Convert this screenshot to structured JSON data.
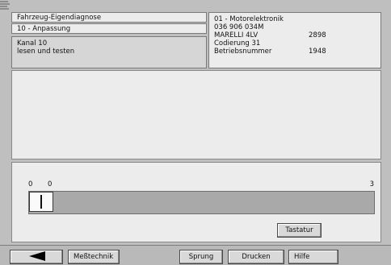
{
  "header_left": {
    "title": "Fahrzeug-Eigendiagnose",
    "function": "10 - Anpassung",
    "channel": "Kanal 10",
    "action": "lesen und testen"
  },
  "header_right": {
    "control_unit": "01 - Motorelektronik",
    "part_number": "036 906 034M",
    "component": "MARELLI 4LV",
    "component_value": "2898",
    "coding": "Codierung 31",
    "workshop_label": "Betriebsnummer",
    "workshop_value": "1948"
  },
  "adaptation": {
    "min_label": "0",
    "current_label": "0",
    "max_label": "3",
    "current_value": 0,
    "max_value": 3,
    "keyboard_button": "Tastatur"
  },
  "toolbar": {
    "back_icon": "arrow-left-icon",
    "measurement_button": "Meßtechnik",
    "jump_button": "Sprung",
    "print_button": "Drucken",
    "help_button": "Hilfe"
  },
  "colors": {
    "background": "#bfbfbf",
    "panel": "#ececec",
    "track": "#a9a9a9"
  }
}
